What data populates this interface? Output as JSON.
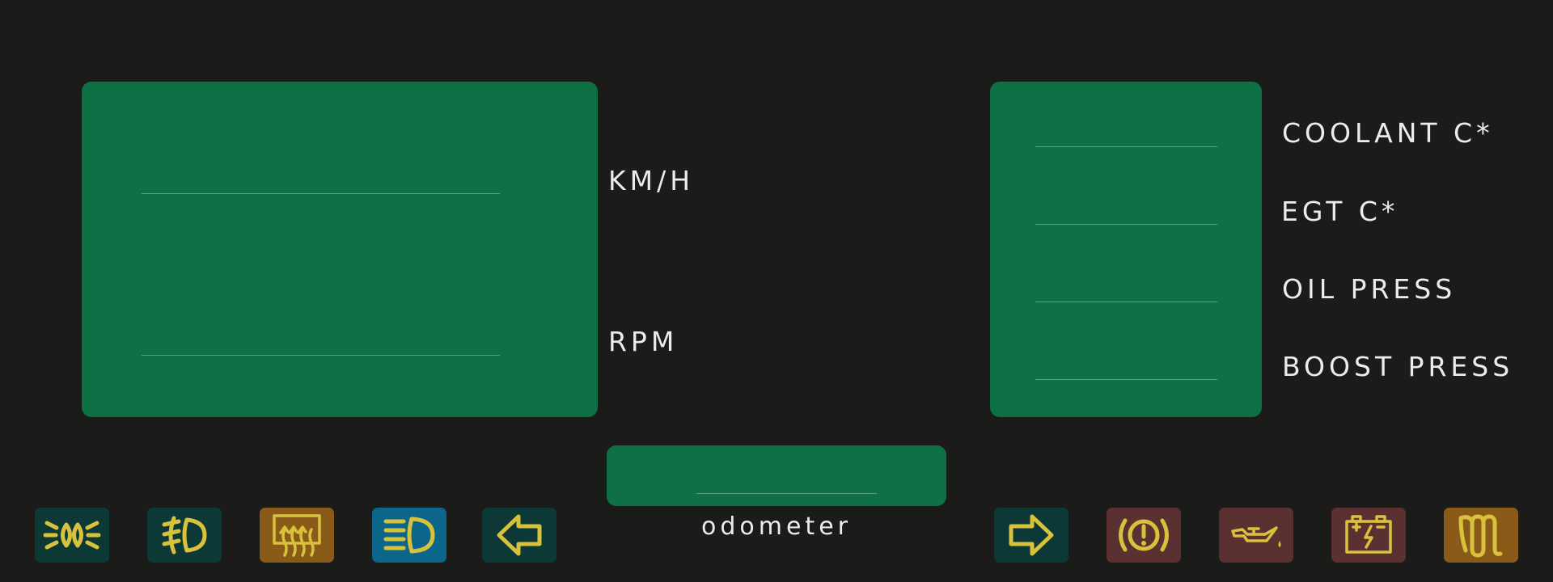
{
  "gauges": {
    "speed_label": "KM/H",
    "rpm_label": "RPM",
    "speed_value": "",
    "rpm_value": ""
  },
  "sensors": {
    "coolant_label": "COOLANT C*",
    "egt_label": "EGT C*",
    "oil_press_label": "OIL PRESS",
    "boost_press_label": "BOOST PRESS"
  },
  "odometer": {
    "label": "odometer",
    "value": ""
  },
  "indicators": {
    "left": [
      {
        "icon": "low-beam-icon",
        "color": "#0c3935"
      },
      {
        "icon": "fog-light-icon",
        "color": "#0c3935"
      },
      {
        "icon": "rear-defrost-icon",
        "color": "#8a5a18"
      },
      {
        "icon": "high-beam-icon",
        "color": "#0b6689"
      },
      {
        "icon": "left-turn-signal-icon",
        "color": "#0c3935"
      }
    ],
    "right": [
      {
        "icon": "right-turn-signal-icon",
        "color": "#0c3935"
      },
      {
        "icon": "brake-warning-icon",
        "color": "#5a3030"
      },
      {
        "icon": "oil-pressure-icon",
        "color": "#5a3030"
      },
      {
        "icon": "battery-icon",
        "color": "#5a3030"
      },
      {
        "icon": "glow-plug-icon",
        "color": "#8a5a18"
      }
    ]
  },
  "colors": {
    "background": "#1b1c1a",
    "panel": "#0e7045",
    "icon": "#d8c13c",
    "label": "#ececea"
  }
}
